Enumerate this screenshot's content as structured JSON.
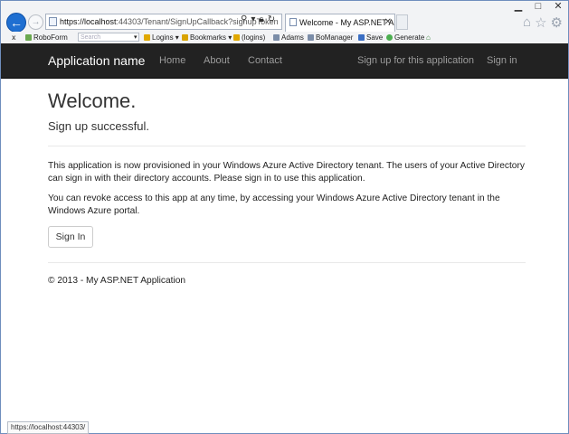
{
  "browser": {
    "address_host_prefix": "https://localhost",
    "address_rest": ":44303/Tenant/SignUpCallback?signupToken",
    "tab_title": "Welcome - My ASP.NET Ap...",
    "status_url": "https://localhost:44303/"
  },
  "favorites": {
    "close": "x",
    "roboform": "RoboForm",
    "search_placeholder": "Search",
    "logins": "Logins",
    "bookmarks": "Bookmarks",
    "logins2": "(logins)",
    "adams": "Adams",
    "bomanager": "BoManager",
    "save": "Save",
    "generate": "Generate"
  },
  "navbar": {
    "brand": "Application name",
    "links": [
      "Home",
      "About",
      "Contact"
    ],
    "right_links": [
      "Sign up for this application",
      "Sign in"
    ]
  },
  "main": {
    "heading": "Welcome.",
    "subtitle": "Sign up successful.",
    "paragraph1": "This application is now provisioned in your Windows Azure Active Directory tenant. The users of your Active Directory can sign in with their directory accounts. Please sign in to use this application.",
    "paragraph2": "You can revoke access to this app at any time, by accessing your Windows Azure Active Directory tenant in the Windows Azure portal.",
    "signin_button": "Sign In"
  },
  "footer": {
    "text": "© 2013 - My ASP.NET Application"
  },
  "colors": {
    "navbar_bg": "#222222",
    "nav_link": "#9d9d9d",
    "back_button": "#1f6fd1"
  }
}
